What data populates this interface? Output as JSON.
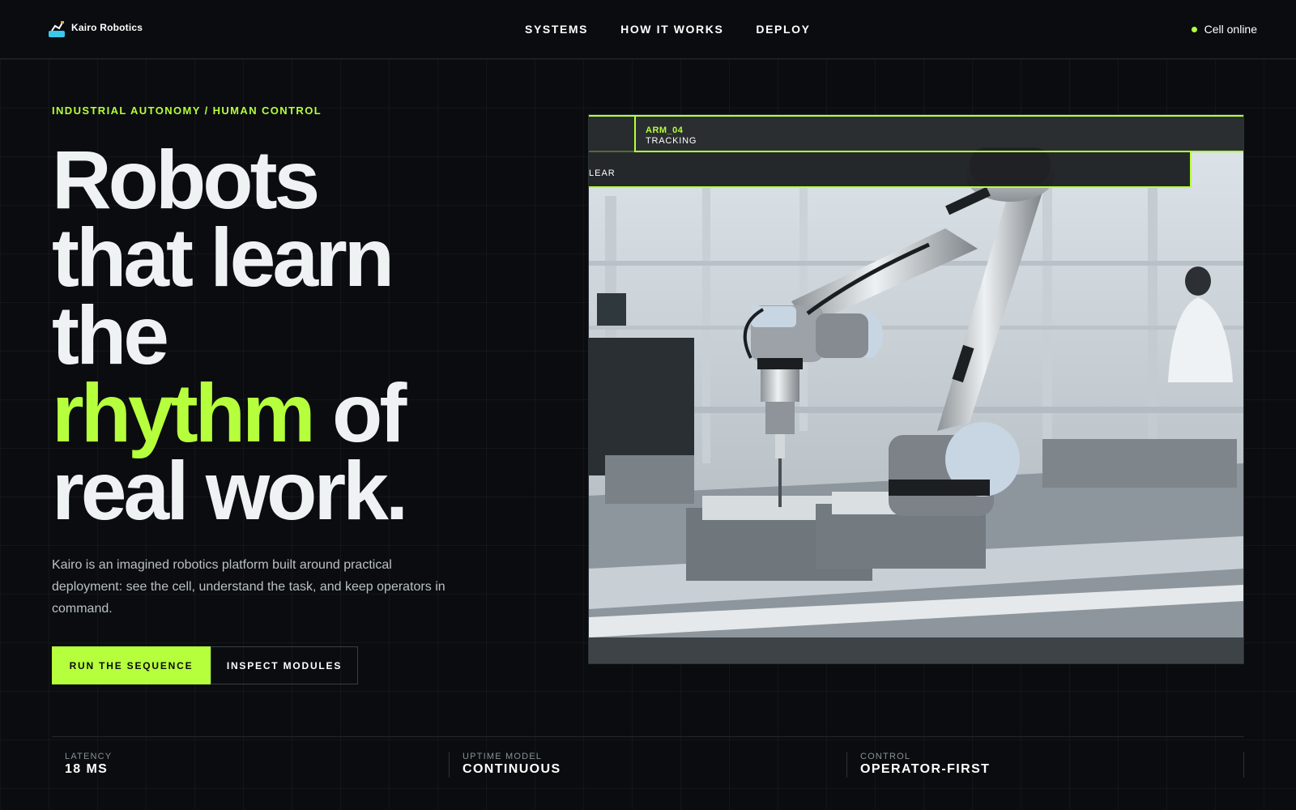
{
  "header": {
    "brand_name": "Kairo Robotics",
    "nav": [
      "SYSTEMS",
      "HOW IT WORKS",
      "DEPLOY"
    ],
    "status": "Cell online"
  },
  "hero": {
    "eyebrow": "INDUSTRIAL AUTONOMY / HUMAN CONTROL",
    "headline": {
      "line1": "Robots",
      "line2": "that learn",
      "line3": "the",
      "line4_accent": "rhythm",
      "line4_rest": "of",
      "line5": "real work."
    },
    "description": "Kairo is an imagined robotics platform built around practical deployment: see the cell, understand the task, and keep operators in command.",
    "primary_button": "RUN THE SEQUENCE",
    "secondary_button": "INSPECT MODULES"
  },
  "visual": {
    "hud_label": "ARM_04",
    "hud_state": "TRACKING",
    "hud_bar_text": "LEAR"
  },
  "stats": [
    {
      "label": "LATENCY",
      "value": "18 MS"
    },
    {
      "label": "UPTIME MODEL",
      "value": "CONTINUOUS"
    },
    {
      "label": "CONTROL",
      "value": "OPERATOR-FIRST"
    }
  ],
  "colors": {
    "background": "#0a0c0f",
    "accent": "#b6ff3c",
    "brand_icon": "#3cc8e8",
    "text": "#eef2f3"
  }
}
